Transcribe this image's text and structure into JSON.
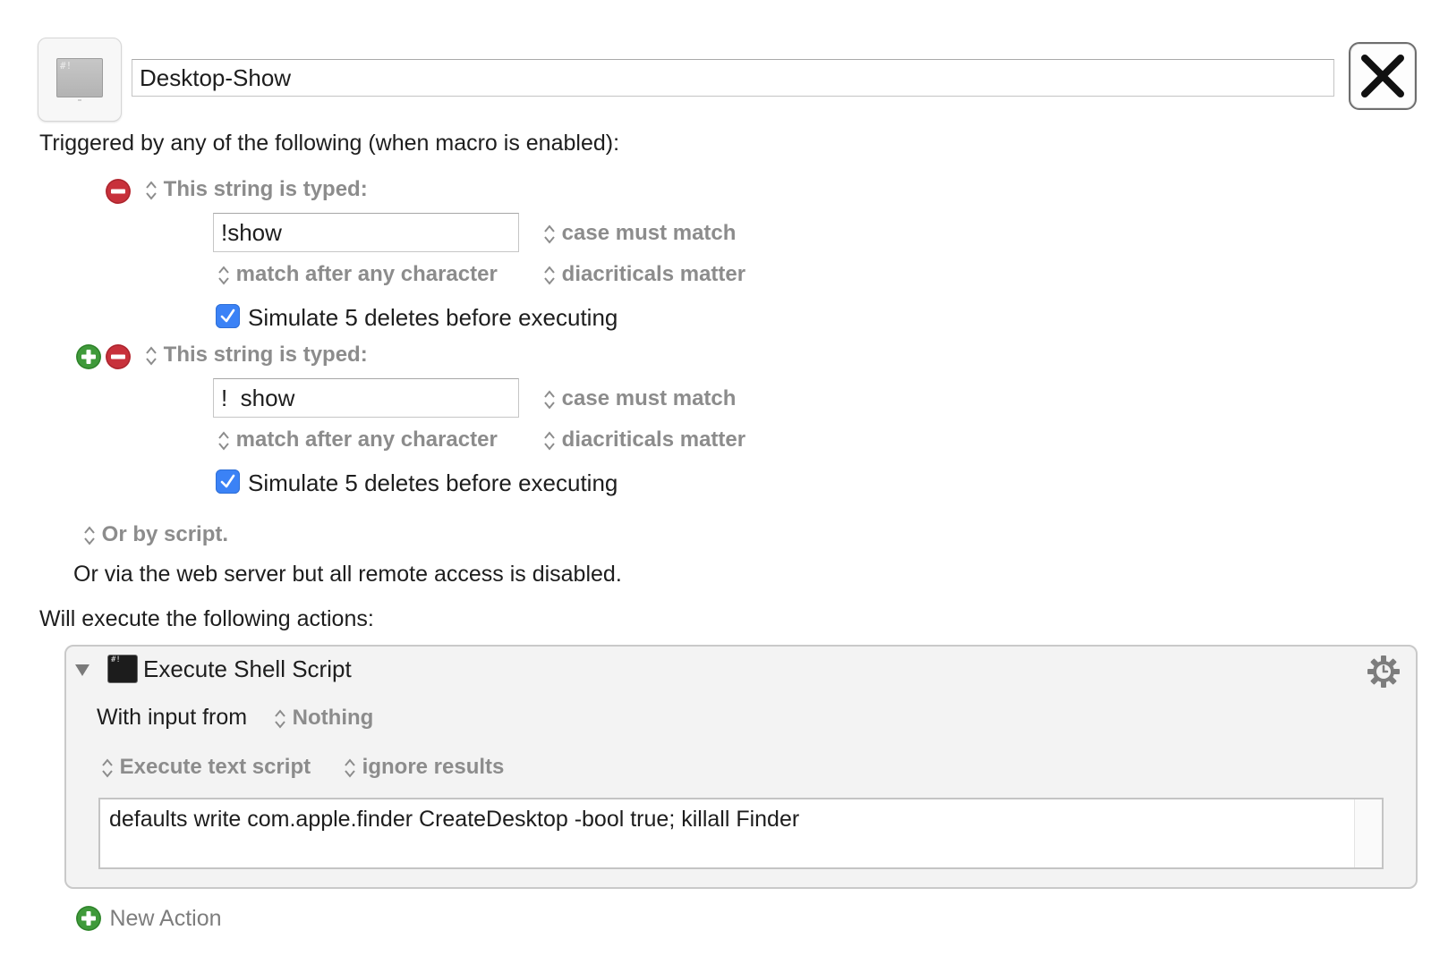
{
  "macro": {
    "name": "Desktop-Show",
    "icon": "shell-script-icon",
    "icon_glyph": "#!",
    "close_icon": "close-x-icon"
  },
  "triggers": {
    "heading": "Triggered by any of the following (when macro is enabled):",
    "items": [
      {
        "type_label": "This string is typed:",
        "string": "!show",
        "case_option": "case must match",
        "match_option": "match after any character",
        "diacritics_option": "diacriticals matter",
        "simulate_label": "Simulate 5 deletes before executing",
        "simulate_checked": true
      },
      {
        "type_label": "This string is typed:",
        "string": "!  show",
        "case_option": "case must match",
        "match_option": "match after any character",
        "diacritics_option": "diacriticals matter",
        "simulate_label": "Simulate 5 deletes before executing",
        "simulate_checked": true
      }
    ],
    "script_option": "Or by script.",
    "web_server_note": "Or via the web server but all remote access is disabled."
  },
  "actions": {
    "heading": "Will execute the following actions:",
    "items": [
      {
        "title": "Execute Shell Script",
        "icon_glyph": "#!",
        "input_label": "With input from",
        "input_value": "Nothing",
        "script_type": "Execute text script",
        "results_option": "ignore results",
        "script_text": "defaults write com.apple.finder CreateDesktop -bool true; killall Finder"
      }
    ],
    "new_action_label": "New Action"
  },
  "colors": {
    "remove_red": "#c8313b",
    "add_green": "#3f9a3a",
    "checkbox_blue": "#3b82f6",
    "option_grey": "#8c8c8c"
  }
}
